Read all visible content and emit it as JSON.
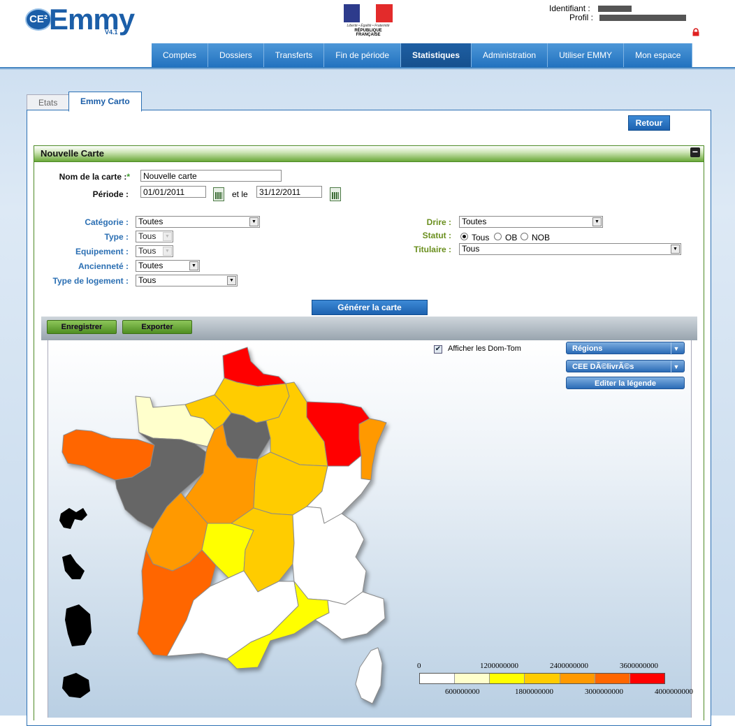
{
  "header": {
    "logo_prefix": "CE²",
    "logo_text": "Emmy",
    "logo_version": "V4.1",
    "rf_motto": "Liberté • Égalité • Fraternité",
    "rf_name": "RÉPUBLIQUE FRANÇAISE",
    "identifiant_label": "Identifiant :",
    "profil_label": "Profil :"
  },
  "nav": {
    "items": [
      {
        "label": "Comptes"
      },
      {
        "label": "Dossiers"
      },
      {
        "label": "Transferts"
      },
      {
        "label": "Fin de période"
      },
      {
        "label": "Statistiques",
        "active": true
      },
      {
        "label": "Administration"
      },
      {
        "label": "Utiliser EMMY"
      },
      {
        "label": "Mon espace"
      }
    ]
  },
  "tabs": {
    "etats": "Etats",
    "carto": "Emmy Carto"
  },
  "retour_label": "Retour",
  "section": {
    "title": "Nouvelle Carte",
    "nom_label": "Nom de la carte :",
    "nom_required": "*",
    "nom_value": "Nouvelle carte",
    "periode_label": "Période :",
    "date_from": "01/01/2011",
    "et_le": "et le",
    "date_to": "31/12/2011"
  },
  "filters": {
    "categorie": {
      "label": "Catégorie :",
      "value": "Toutes"
    },
    "type": {
      "label": "Type :",
      "value": "Tous"
    },
    "equipement": {
      "label": "Equipement :",
      "value": "Tous"
    },
    "anciennete": {
      "label": "Ancienneté :",
      "value": "Toutes"
    },
    "logement": {
      "label": "Type de logement :",
      "value": "Tous"
    },
    "drire": {
      "label": "Drire :",
      "value": "Toutes"
    },
    "statut": {
      "label": "Statut :",
      "options": [
        "Tous",
        "OB",
        "NOB"
      ],
      "selected": "Tous"
    },
    "titulaire": {
      "label": "Titulaire :",
      "value": "Tous"
    }
  },
  "generate_label": "Générer la carte",
  "toolbar": {
    "save_label": "Enregistrer",
    "export_label": "Exporter"
  },
  "map": {
    "domtom_label": "Afficher les Dom-Tom",
    "regions_label": "Régions",
    "measure_label": "CEE DÃ©livrÃ©s",
    "legend_edit_label": "Editer la légende",
    "legend_top": [
      "0",
      "1200000000",
      "2400000000",
      "3600000000"
    ],
    "legend_bottom": [
      "600000000",
      "1800000000",
      "3000000000",
      "4000000000"
    ],
    "legend_colors": [
      "#ffffff",
      "#ffffcc",
      "#ffff00",
      "#ffcc00",
      "#ff9900",
      "#ff6600",
      "#ff0000"
    ]
  }
}
